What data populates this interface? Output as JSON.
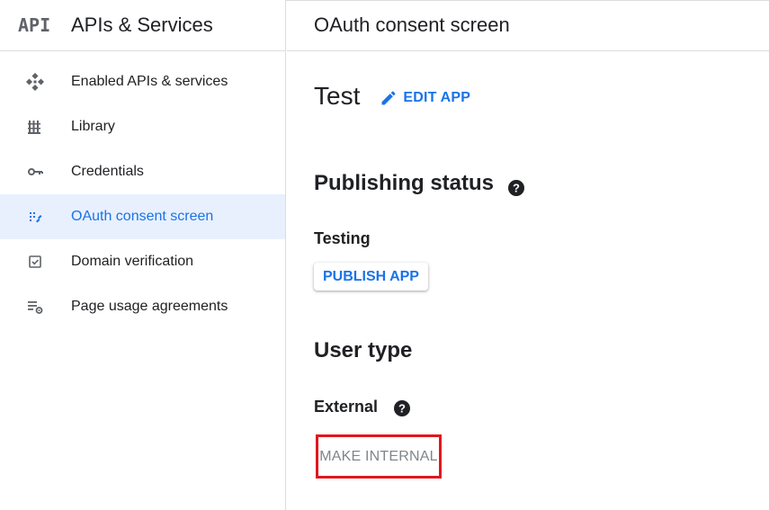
{
  "sidebar": {
    "product_title": "APIs & Services",
    "logo_text": "API",
    "items": [
      {
        "label": "Enabled APIs & services",
        "icon": "enabled-apis-icon"
      },
      {
        "label": "Library",
        "icon": "library-icon"
      },
      {
        "label": "Credentials",
        "icon": "key-icon"
      },
      {
        "label": "OAuth consent screen",
        "icon": "oauth-consent-icon",
        "active": true
      },
      {
        "label": "Domain verification",
        "icon": "checkbox-icon"
      },
      {
        "label": "Page usage agreements",
        "icon": "settings-list-icon"
      }
    ]
  },
  "header": {
    "title": "OAuth consent screen"
  },
  "app": {
    "name": "Test",
    "edit_label": "EDIT APP"
  },
  "publishing": {
    "title": "Publishing status",
    "status": "Testing",
    "publish_label": "PUBLISH APP"
  },
  "user_type": {
    "title": "User type",
    "value": "External",
    "make_internal_label": "MAKE INTERNAL"
  },
  "colors": {
    "accent": "#1a73e8",
    "active_bg": "#e8f0fe",
    "highlight_box": "#e0171f",
    "disabled_text": "#80868b"
  }
}
